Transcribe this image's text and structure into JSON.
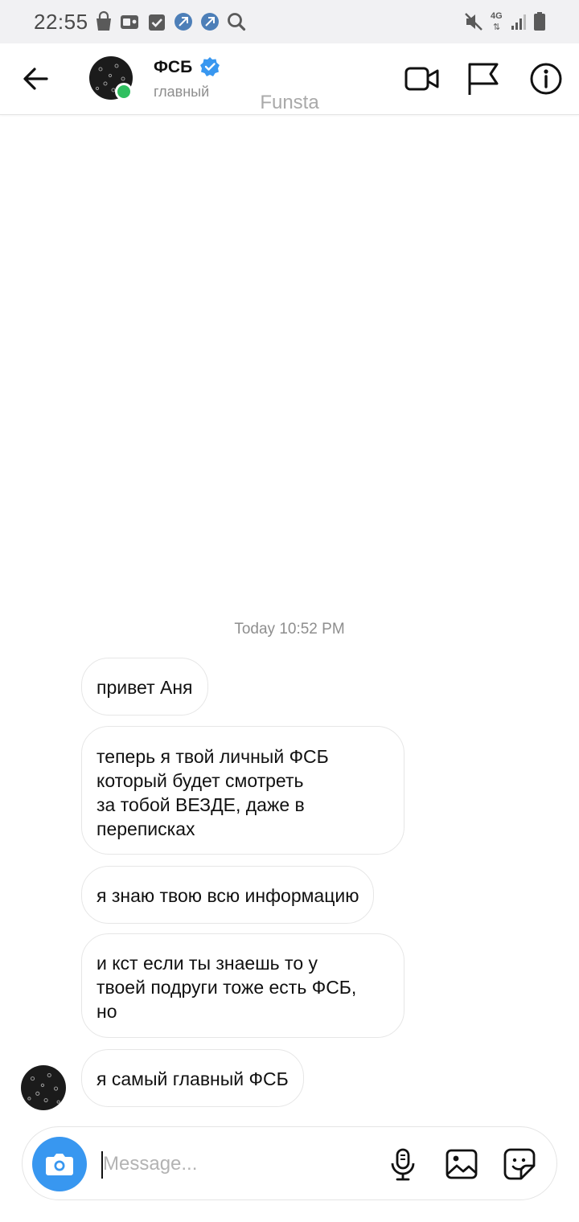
{
  "status_bar": {
    "time": "22:55",
    "left_icons": [
      "shopping-bag-icon",
      "radio-icon",
      "checkbox-icon",
      "app-icon",
      "app-icon",
      "search-icon"
    ],
    "network": "4G",
    "right_icons": [
      "mute-icon",
      "network-4g-icon",
      "signal-icon",
      "battery-icon"
    ]
  },
  "header": {
    "contact_name": "ФСБ",
    "verified": true,
    "contact_subtitle": "главный",
    "watermark": "Funsta",
    "online": true,
    "online_color": "#2fbf5f",
    "verified_color": "#3897f0"
  },
  "chat": {
    "timestamp": "Today 10:52 PM",
    "messages": [
      {
        "text": "привет Аня"
      },
      {
        "text": "теперь я твой личный ФСБ\nкоторый будет смотреть\nза тобой ВЕЗДЕ, даже в\nпереписках"
      },
      {
        "text": "я знаю твою всю информацию"
      },
      {
        "text": "и кст если ты знаешь то у\nтвоей подруги тоже есть ФСБ,\nно"
      },
      {
        "text": "я самый главный ФСБ"
      }
    ]
  },
  "composer": {
    "placeholder": "Message...",
    "value": "",
    "accent": "#3897f0"
  }
}
